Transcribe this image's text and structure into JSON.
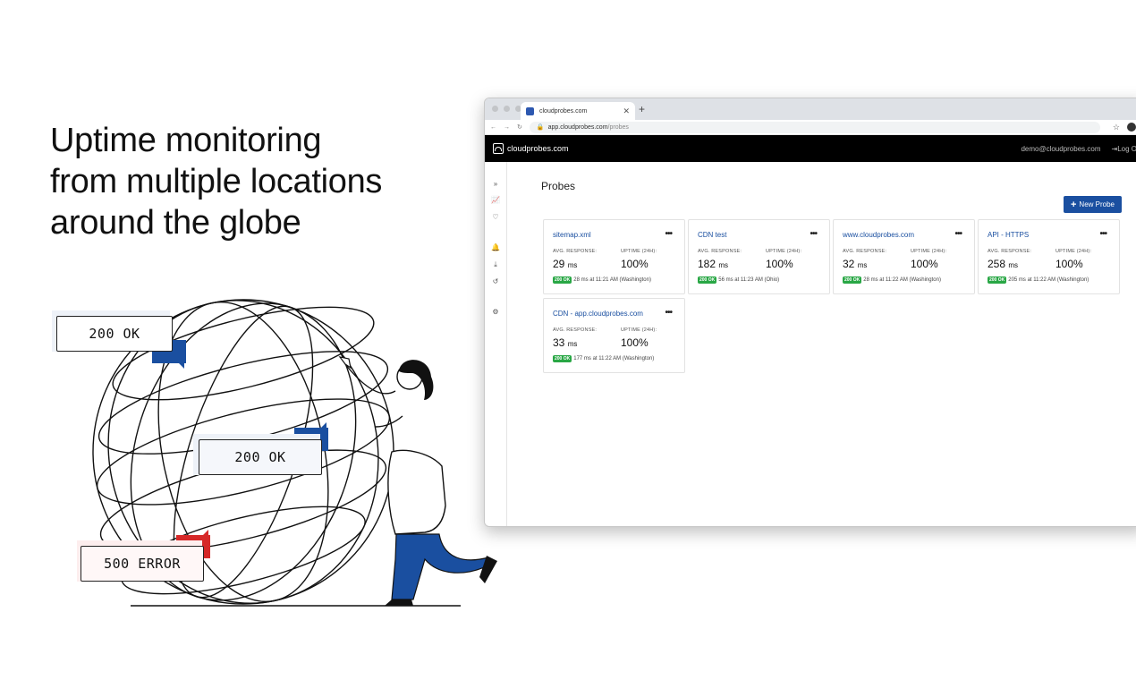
{
  "headline": [
    "Uptime monitoring",
    "from multiple locations",
    "around the globe"
  ],
  "tags": {
    "ok_top": "200 OK",
    "ok_middle": "200 OK",
    "error": "500 ERROR"
  },
  "browser": {
    "tab_title": "cloudprobes.com",
    "url_host": "app.cloudprobes.com",
    "url_path": "/probes",
    "new_tab_label": "+"
  },
  "app": {
    "brand": "cloudprobes.com",
    "user_email": "demo@cloudprobes.com",
    "logout_label": "Log O",
    "page_title": "Probes",
    "new_probe_label": "New Probe"
  },
  "sidebar_icons": [
    "chevron-right-icon",
    "chart-icon",
    "heart-icon",
    "bell-icon",
    "download-icon",
    "history-icon",
    "gear-icon"
  ],
  "probes": [
    {
      "name": "sitemap.xml",
      "avg_label": "AVG. RESPONSE:",
      "avg": "29",
      "unit": "ms",
      "uptime_label": "UPTIME (24H):",
      "uptime": "100%",
      "badge": "200 OK",
      "status": "28 ms at 11:21 AM (Washington)"
    },
    {
      "name": "CDN test",
      "avg_label": "AVG. RESPONSE:",
      "avg": "182",
      "unit": "ms",
      "uptime_label": "UPTIME (24H):",
      "uptime": "100%",
      "badge": "200 OK",
      "status": "56 ms at 11:23 AM (Ohio)"
    },
    {
      "name": "www.cloudprobes.com",
      "avg_label": "AVG. RESPONSE:",
      "avg": "32",
      "unit": "ms",
      "uptime_label": "UPTIME (24H):",
      "uptime": "100%",
      "badge": "200 OK",
      "status": "28 ms at 11:22 AM (Washington)"
    },
    {
      "name": "API - HTTPS",
      "avg_label": "AVG. RESPONSE:",
      "avg": "258",
      "unit": "ms",
      "uptime_label": "UPTIME (24H):",
      "uptime": "100%",
      "badge": "200 OK",
      "status": "205 ms at 11:22 AM (Washington)"
    },
    {
      "name": "CDN - app.cloudprobes.com",
      "avg_label": "AVG. RESPONSE:",
      "avg": "33",
      "unit": "ms",
      "uptime_label": "UPTIME (24H):",
      "uptime": "100%",
      "badge": "200 OK",
      "status": "177 ms at 11:22 AM (Washington)"
    }
  ],
  "colors": {
    "accent": "#1a4fa0",
    "ok_flag": "#1a4fa0",
    "error_flag": "#d62828",
    "success_badge": "#29a745",
    "appbar": "#000000"
  }
}
